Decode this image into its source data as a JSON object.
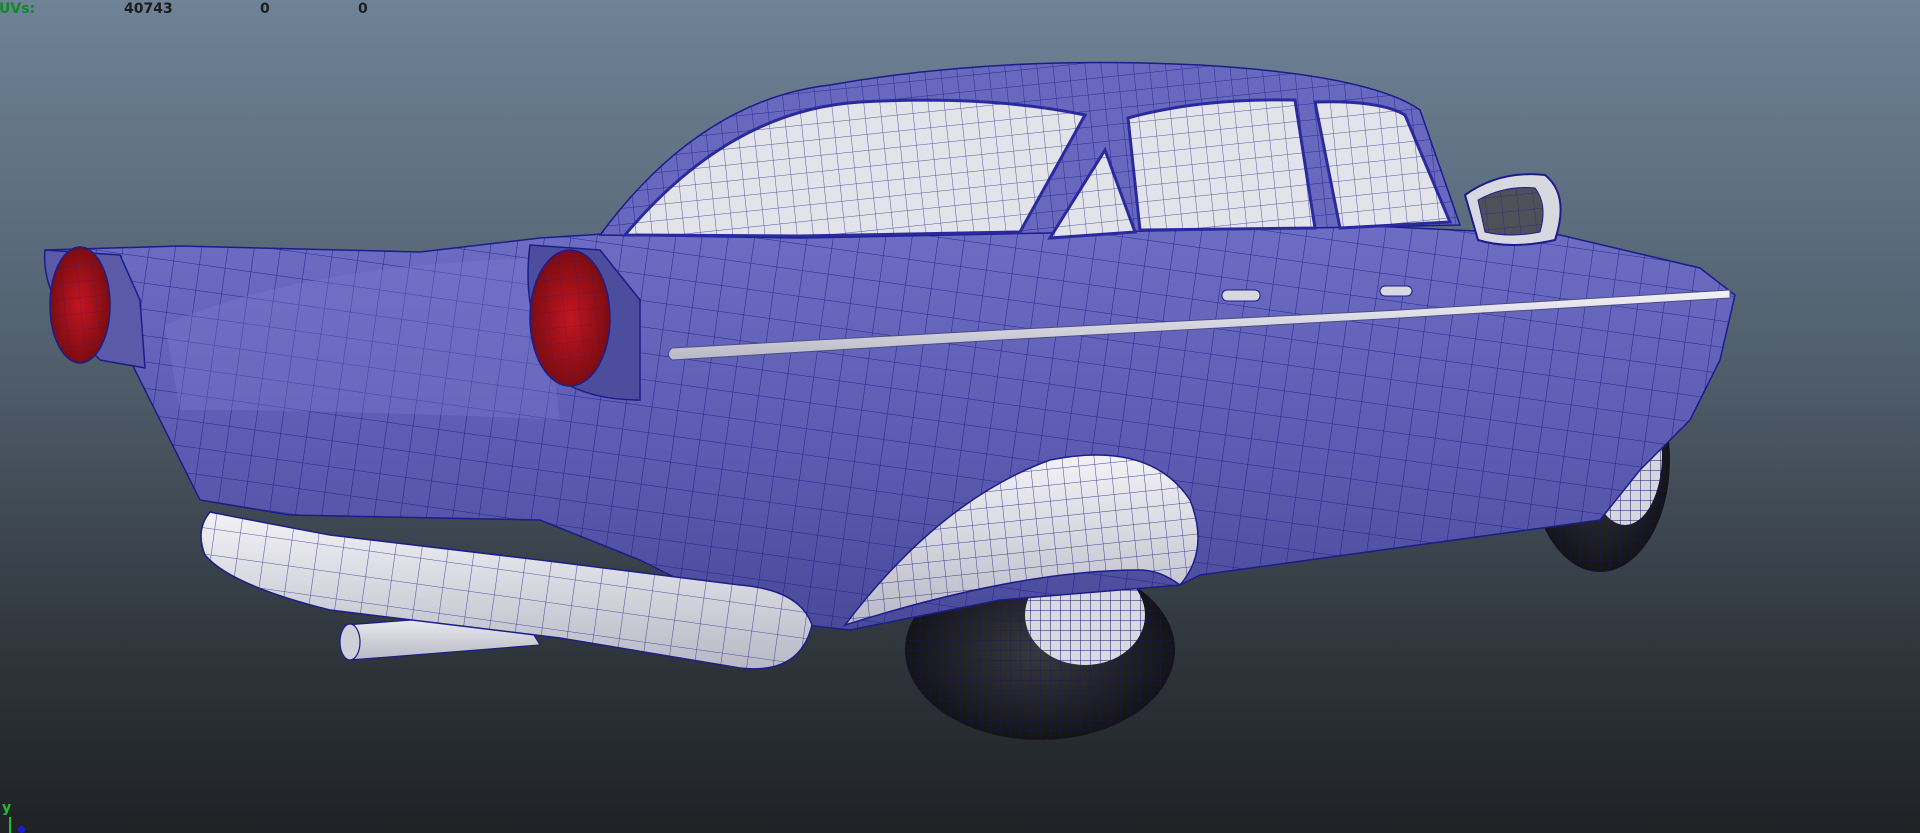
{
  "hud": {
    "label": "UVs:",
    "values": [
      "40743",
      "0",
      "0"
    ]
  },
  "axis": {
    "y_label": "y"
  },
  "colors": {
    "background_top": "#6e8397",
    "background_bottom": "#1f2225",
    "body": "#5f5fb6",
    "wire": "#1c1c8c",
    "chrome": "#e4e4ea",
    "taillight": "#a1121a",
    "hud_label": "#0f8a28"
  },
  "scene": {
    "object": "car-model",
    "display": "wireframe-on-shaded"
  }
}
